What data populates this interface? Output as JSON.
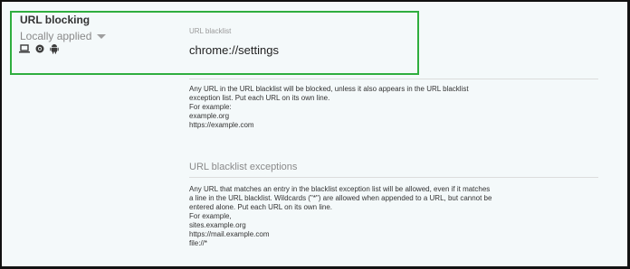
{
  "policy": {
    "name": "URL blocking",
    "status": "Locally applied"
  },
  "platform_icons": [
    "laptop-icon",
    "chrome-icon",
    "android-icon"
  ],
  "blacklist": {
    "label": "URL blacklist",
    "value": "chrome://settings",
    "description": [
      "Any URL in the URL blacklist will be blocked, unless it also appears in the URL blacklist",
      "exception list. Put each URL on its own line.",
      "For example:",
      "example.org",
      "https://example.com"
    ]
  },
  "exceptions": {
    "heading": "URL blacklist exceptions",
    "description": [
      "Any URL that matches an entry in the blacklist exception list will be allowed, even if it matches",
      "a line in the URL blacklist. Wildcards (\"*\") are allowed when appended to a URL, but cannot be",
      "entered alone. Put each URL on its own line.",
      "For example,",
      "sites.example.org",
      "https://mail.example.com",
      "file://*"
    ]
  },
  "colors": {
    "highlight_border": "#2fae3f",
    "background": "#f4f9fa"
  }
}
